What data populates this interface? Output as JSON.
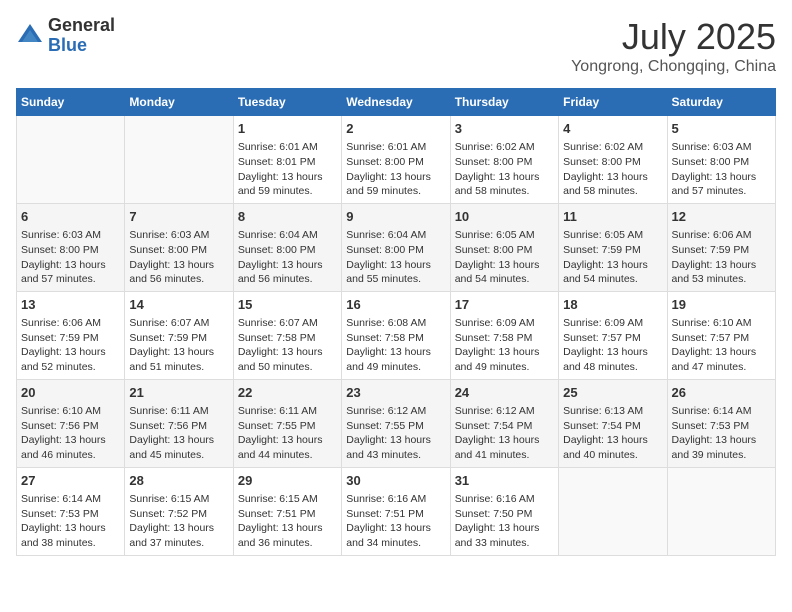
{
  "logo": {
    "text_general": "General",
    "text_blue": "Blue"
  },
  "title": "July 2025",
  "subtitle": "Yongrong, Chongqing, China",
  "weekdays": [
    "Sunday",
    "Monday",
    "Tuesday",
    "Wednesday",
    "Thursday",
    "Friday",
    "Saturday"
  ],
  "weeks": [
    [
      {
        "day": "",
        "info": ""
      },
      {
        "day": "",
        "info": ""
      },
      {
        "day": "1",
        "info": "Sunrise: 6:01 AM\nSunset: 8:01 PM\nDaylight: 13 hours and 59 minutes."
      },
      {
        "day": "2",
        "info": "Sunrise: 6:01 AM\nSunset: 8:00 PM\nDaylight: 13 hours and 59 minutes."
      },
      {
        "day": "3",
        "info": "Sunrise: 6:02 AM\nSunset: 8:00 PM\nDaylight: 13 hours and 58 minutes."
      },
      {
        "day": "4",
        "info": "Sunrise: 6:02 AM\nSunset: 8:00 PM\nDaylight: 13 hours and 58 minutes."
      },
      {
        "day": "5",
        "info": "Sunrise: 6:03 AM\nSunset: 8:00 PM\nDaylight: 13 hours and 57 minutes."
      }
    ],
    [
      {
        "day": "6",
        "info": "Sunrise: 6:03 AM\nSunset: 8:00 PM\nDaylight: 13 hours and 57 minutes."
      },
      {
        "day": "7",
        "info": "Sunrise: 6:03 AM\nSunset: 8:00 PM\nDaylight: 13 hours and 56 minutes."
      },
      {
        "day": "8",
        "info": "Sunrise: 6:04 AM\nSunset: 8:00 PM\nDaylight: 13 hours and 56 minutes."
      },
      {
        "day": "9",
        "info": "Sunrise: 6:04 AM\nSunset: 8:00 PM\nDaylight: 13 hours and 55 minutes."
      },
      {
        "day": "10",
        "info": "Sunrise: 6:05 AM\nSunset: 8:00 PM\nDaylight: 13 hours and 54 minutes."
      },
      {
        "day": "11",
        "info": "Sunrise: 6:05 AM\nSunset: 7:59 PM\nDaylight: 13 hours and 54 minutes."
      },
      {
        "day": "12",
        "info": "Sunrise: 6:06 AM\nSunset: 7:59 PM\nDaylight: 13 hours and 53 minutes."
      }
    ],
    [
      {
        "day": "13",
        "info": "Sunrise: 6:06 AM\nSunset: 7:59 PM\nDaylight: 13 hours and 52 minutes."
      },
      {
        "day": "14",
        "info": "Sunrise: 6:07 AM\nSunset: 7:59 PM\nDaylight: 13 hours and 51 minutes."
      },
      {
        "day": "15",
        "info": "Sunrise: 6:07 AM\nSunset: 7:58 PM\nDaylight: 13 hours and 50 minutes."
      },
      {
        "day": "16",
        "info": "Sunrise: 6:08 AM\nSunset: 7:58 PM\nDaylight: 13 hours and 49 minutes."
      },
      {
        "day": "17",
        "info": "Sunrise: 6:09 AM\nSunset: 7:58 PM\nDaylight: 13 hours and 49 minutes."
      },
      {
        "day": "18",
        "info": "Sunrise: 6:09 AM\nSunset: 7:57 PM\nDaylight: 13 hours and 48 minutes."
      },
      {
        "day": "19",
        "info": "Sunrise: 6:10 AM\nSunset: 7:57 PM\nDaylight: 13 hours and 47 minutes."
      }
    ],
    [
      {
        "day": "20",
        "info": "Sunrise: 6:10 AM\nSunset: 7:56 PM\nDaylight: 13 hours and 46 minutes."
      },
      {
        "day": "21",
        "info": "Sunrise: 6:11 AM\nSunset: 7:56 PM\nDaylight: 13 hours and 45 minutes."
      },
      {
        "day": "22",
        "info": "Sunrise: 6:11 AM\nSunset: 7:55 PM\nDaylight: 13 hours and 44 minutes."
      },
      {
        "day": "23",
        "info": "Sunrise: 6:12 AM\nSunset: 7:55 PM\nDaylight: 13 hours and 43 minutes."
      },
      {
        "day": "24",
        "info": "Sunrise: 6:12 AM\nSunset: 7:54 PM\nDaylight: 13 hours and 41 minutes."
      },
      {
        "day": "25",
        "info": "Sunrise: 6:13 AM\nSunset: 7:54 PM\nDaylight: 13 hours and 40 minutes."
      },
      {
        "day": "26",
        "info": "Sunrise: 6:14 AM\nSunset: 7:53 PM\nDaylight: 13 hours and 39 minutes."
      }
    ],
    [
      {
        "day": "27",
        "info": "Sunrise: 6:14 AM\nSunset: 7:53 PM\nDaylight: 13 hours and 38 minutes."
      },
      {
        "day": "28",
        "info": "Sunrise: 6:15 AM\nSunset: 7:52 PM\nDaylight: 13 hours and 37 minutes."
      },
      {
        "day": "29",
        "info": "Sunrise: 6:15 AM\nSunset: 7:51 PM\nDaylight: 13 hours and 36 minutes."
      },
      {
        "day": "30",
        "info": "Sunrise: 6:16 AM\nSunset: 7:51 PM\nDaylight: 13 hours and 34 minutes."
      },
      {
        "day": "31",
        "info": "Sunrise: 6:16 AM\nSunset: 7:50 PM\nDaylight: 13 hours and 33 minutes."
      },
      {
        "day": "",
        "info": ""
      },
      {
        "day": "",
        "info": ""
      }
    ]
  ]
}
